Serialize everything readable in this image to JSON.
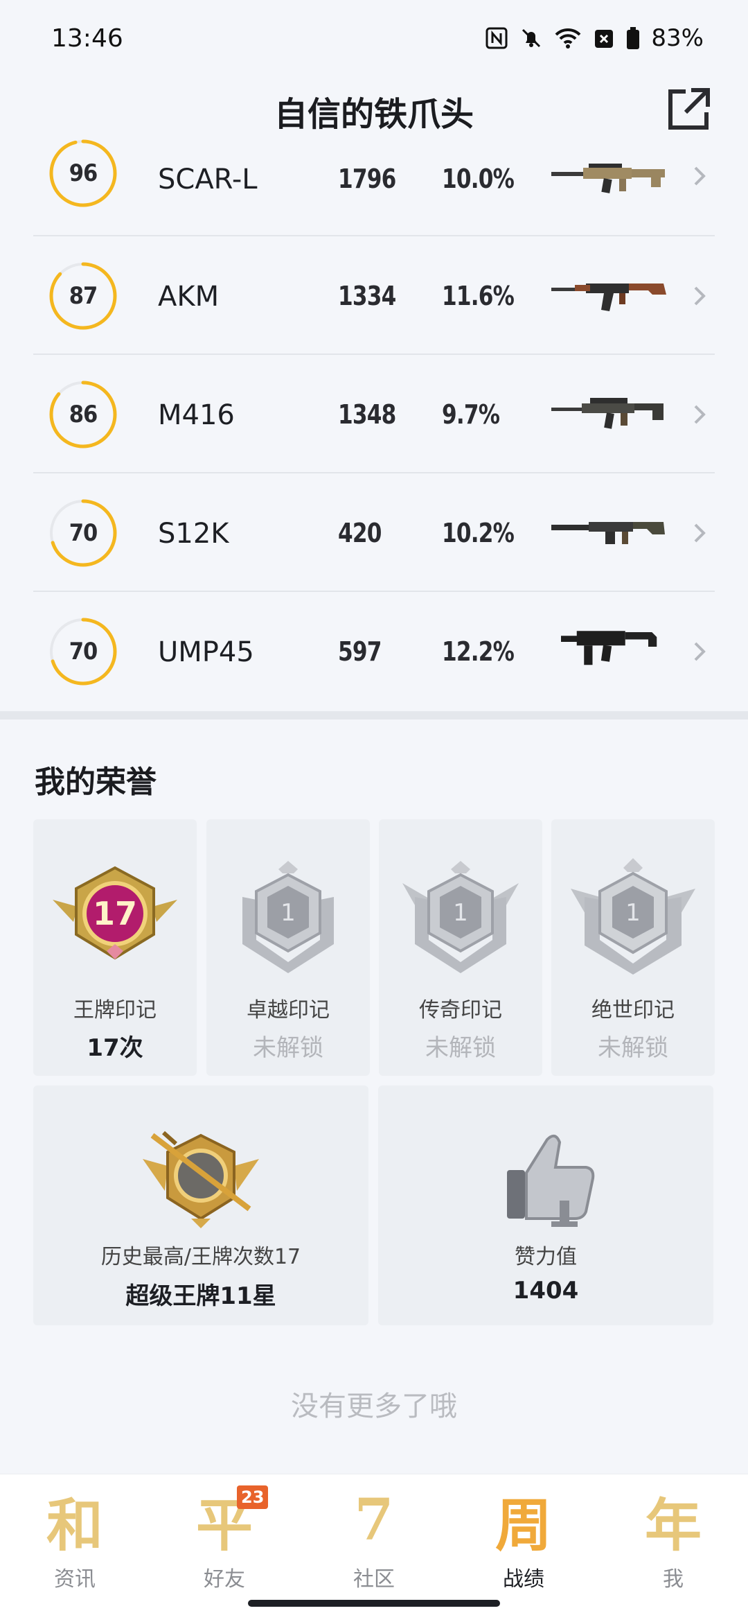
{
  "status_bar": {
    "time": "13:46",
    "battery": "83%"
  },
  "header": {
    "title": "自信的铁爪头",
    "share_icon": "external-link-icon"
  },
  "weapons": [
    {
      "score": "96",
      "score_fraction": 0.96,
      "name": "SCAR-L",
      "count": "1796",
      "percent": "10.0%"
    },
    {
      "score": "87",
      "score_fraction": 0.87,
      "name": "AKM",
      "count": "1334",
      "percent": "11.6%"
    },
    {
      "score": "86",
      "score_fraction": 0.86,
      "name": "M416",
      "count": "1348",
      "percent": "9.7%"
    },
    {
      "score": "70",
      "score_fraction": 0.7,
      "name": "S12K",
      "count": "420",
      "percent": "10.2%"
    },
    {
      "score": "70",
      "score_fraction": 0.7,
      "name": "UMP45",
      "count": "597",
      "percent": "12.2%"
    }
  ],
  "honors": {
    "title": "我的荣誉",
    "badges": [
      {
        "label": "王牌印记",
        "value": "17次",
        "badge_number": "17",
        "locked": false
      },
      {
        "label": "卓越印记",
        "value": "未解锁",
        "badge_number": "1",
        "locked": true
      },
      {
        "label": "传奇印记",
        "value": "未解锁",
        "badge_number": "1",
        "locked": true
      },
      {
        "label": "绝世印记",
        "value": "未解锁",
        "badge_number": "1",
        "locked": true
      }
    ],
    "highest": {
      "label": "历史最高/王牌次数17",
      "value": "超级王牌11星"
    },
    "likes": {
      "label": "赞力值",
      "value": "1404"
    }
  },
  "end_text": "没有更多了哦",
  "nav": {
    "items": [
      {
        "label": "资讯",
        "glyph": "和"
      },
      {
        "label": "好友",
        "glyph": "平",
        "badge": "23"
      },
      {
        "label": "社区",
        "glyph": "7"
      },
      {
        "label": "战绩",
        "glyph": "周"
      },
      {
        "label": "我",
        "glyph": "年"
      }
    ],
    "active_index": 3
  },
  "colors": {
    "ring_active": "#f4b71f",
    "ring_track": "#e6e8ec",
    "nav_gold": "#e7c77a",
    "badge_orange": "#e8632b"
  }
}
